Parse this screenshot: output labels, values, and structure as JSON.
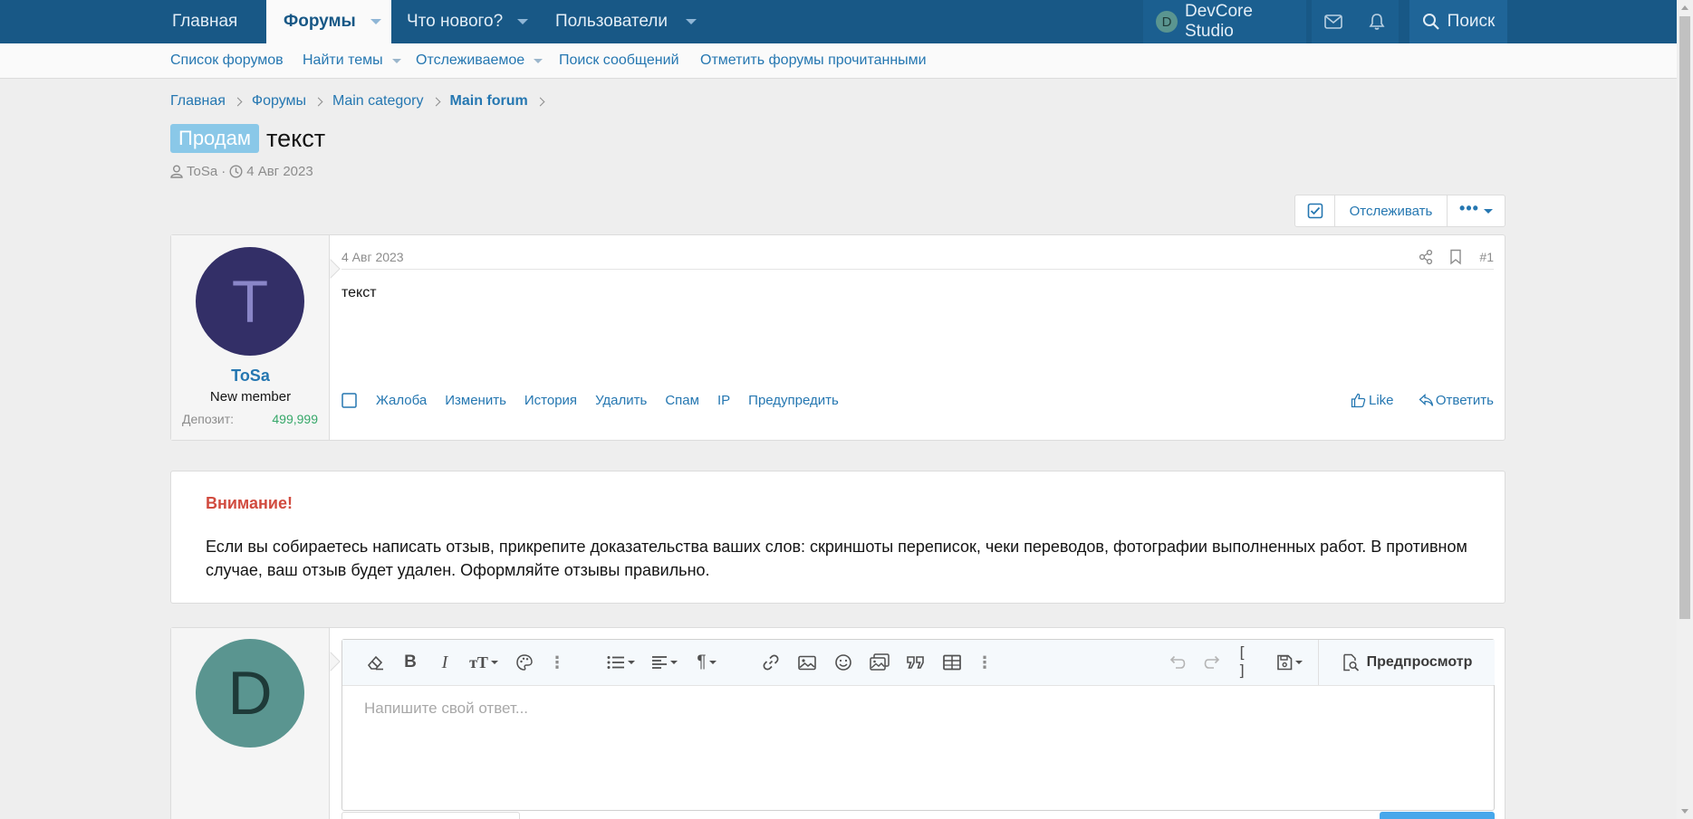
{
  "nav": {
    "items": [
      {
        "label": "Главная"
      },
      {
        "label": "Форумы"
      },
      {
        "label": "Что нового?"
      },
      {
        "label": "Пользователи"
      }
    ],
    "user": {
      "initial": "D",
      "name": "DevCore Studio"
    },
    "search_label": "Поиск"
  },
  "subnav": {
    "items": [
      {
        "label": "Список форумов"
      },
      {
        "label": "Найти темы"
      },
      {
        "label": "Отслеживаемое"
      },
      {
        "label": "Поиск сообщений"
      },
      {
        "label": "Отметить форумы прочитанными"
      }
    ]
  },
  "breadcrumb": [
    "Главная",
    "Форумы",
    "Main category",
    "Main forum"
  ],
  "thread": {
    "prefix": "Продам",
    "title": "текст",
    "author": "ToSa",
    "date": "4 Авг 2023",
    "watch_label": "Отслеживать"
  },
  "post": {
    "date": "4 Авг 2023",
    "number": "#1",
    "body": "текст",
    "user": {
      "initial": "T",
      "name": "ToSa",
      "title": "New member",
      "deposit_label": "Депозит:",
      "deposit_value": "499,999"
    },
    "actions": [
      "Жалоба",
      "Изменить",
      "История",
      "Удалить",
      "Спам",
      "IP",
      "Предупредить"
    ],
    "like_label": "Like",
    "reply_label": "Ответить"
  },
  "notice": {
    "heading": "Внимание!",
    "text": "Если вы собираетесь написать отзыв, прикрепите доказательства ваших слов: скриншоты переписок, чеки переводов, фотографии выполненных работ. В противном случае, ваш отзыв будет удален. Оформляйте отзывы правильно."
  },
  "reply": {
    "avatar_initial": "D",
    "placeholder": "Напишите свой ответ...",
    "preview_label": "Предпросмотр"
  },
  "colors": {
    "nav_bg": "#185886",
    "link": "#2577b1",
    "prefix_bg": "#8ac8e8",
    "poster_avatar_bg": "#332f67",
    "reply_avatar_bg": "#5a9590",
    "notice_heading": "#d14b3f",
    "deposit_value": "#37a86a"
  }
}
